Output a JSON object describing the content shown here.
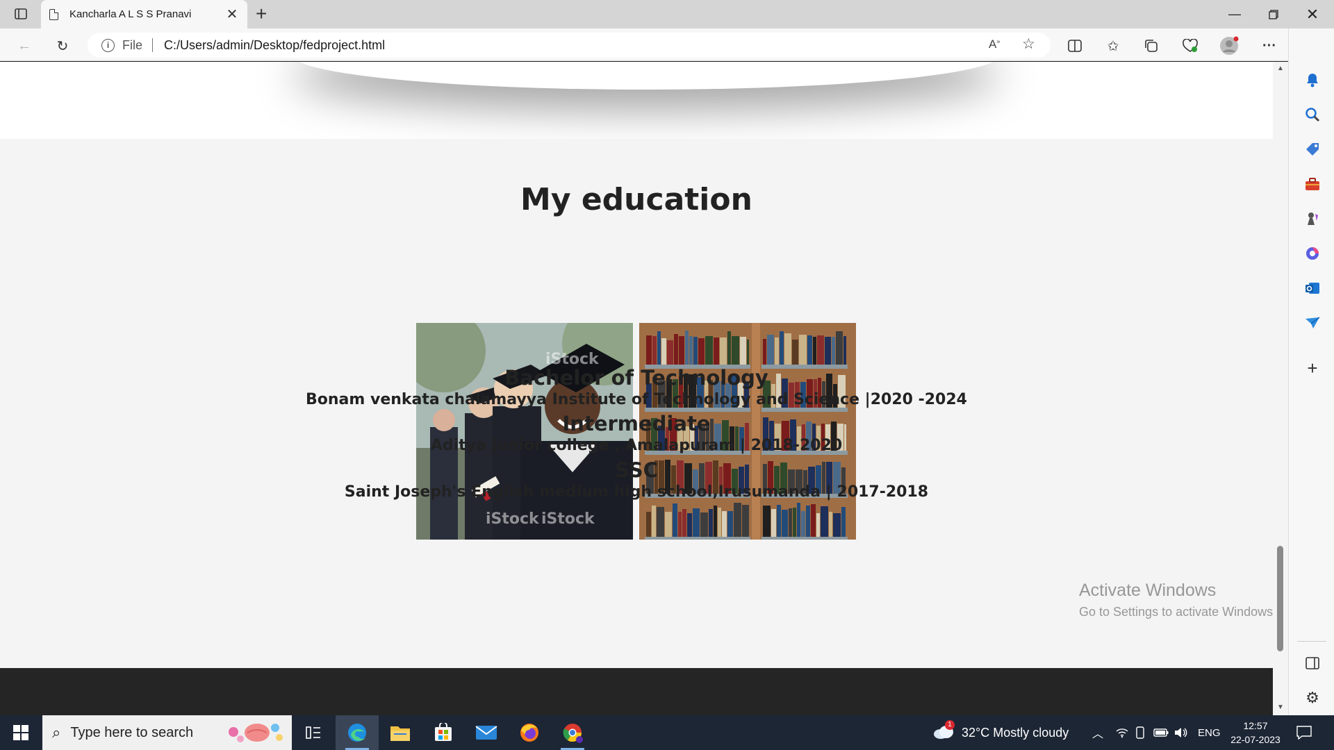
{
  "browser": {
    "tab_title": "Kancharla A L S S Pranavi",
    "address_scheme": "File",
    "address_url": "C:/Users/admin/Desktop/fedproject.html"
  },
  "page": {
    "heading": "My education",
    "education": [
      {
        "title": "Bachelor of Technology",
        "detail": "Bonam venkata chalamayya Institute of Technology and Science |2020 -2024"
      },
      {
        "title": "Intermediate",
        "detail": "Aditya junior college , Amalapuram | 2018-2020"
      },
      {
        "title": "SSC",
        "detail": "Saint Joseph's English medium high school,Irusumanda | 2017-2018"
      }
    ],
    "images": [
      {
        "name": "graduation-photo",
        "watermark": "iStock"
      },
      {
        "name": "bookshelf-photo",
        "watermark": ""
      }
    ]
  },
  "watermark": {
    "line1": "Activate Windows",
    "line2": "Go to Settings to activate Windows."
  },
  "taskbar": {
    "search_placeholder": "Type here to search",
    "weather": "32°C  Mostly cloudy",
    "weather_badge": "1",
    "language": "ENG",
    "time": "12:57",
    "date": "22-07-2023"
  },
  "colors": {
    "page_bg": "#f4f4f4",
    "footer_bg": "#252525",
    "taskbar_bg": "#1d2635",
    "edge_accent": "#1f7fd6"
  },
  "icons": {
    "toolbar": [
      "back-icon",
      "refresh-icon",
      "info-icon",
      "read-aloud-icon",
      "favorite-star-icon",
      "split-screen-icon",
      "favorites-icon",
      "collections-icon",
      "browser-essentials-icon",
      "profile-icon",
      "more-icon",
      "bing-copilot-icon"
    ],
    "sidebar": [
      "bell-icon",
      "search-icon",
      "shopping-tag-icon",
      "tools-briefcase-icon",
      "games-icon",
      "microsoft-365-icon",
      "outlook-icon",
      "drop-icon",
      "add-icon",
      "sidebar-toggle-icon",
      "settings-icon"
    ]
  }
}
